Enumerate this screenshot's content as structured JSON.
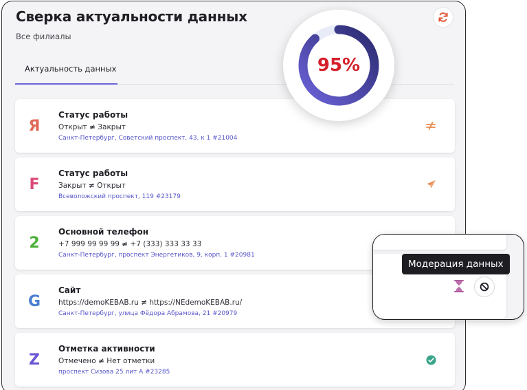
{
  "header": {
    "title": "Сверка актуальности данных",
    "subtitle": "Все филиалы"
  },
  "tabs": [
    {
      "label": "Актуальность данных",
      "active": true
    }
  ],
  "progress": {
    "value": 95,
    "label": "95%",
    "color": "#d4202a",
    "ring_colors": [
      "#6c63d9",
      "#2a2a6e"
    ],
    "track_color": "#e8ecf8"
  },
  "cards": [
    {
      "letter": "Я",
      "letter_color": "#e06a58",
      "title": "Статус работы",
      "compare": {
        "left": "Открыт",
        "sign": "≠",
        "right": "Закрыт"
      },
      "address": "Санкт-Петербург, Советский проспект, 43, к 1 #21004",
      "status_icon": "not-equal-icon",
      "status_color": "#e8894d"
    },
    {
      "letter": "F",
      "letter_color": "#d94a77",
      "title": "Статус работы",
      "compare": {
        "left": "Закрыт",
        "sign": "≠",
        "right": "Открыт"
      },
      "address": "Всеволожский проспект, 119 #23179",
      "status_icon": "send-icon",
      "status_color": "#e8894d"
    },
    {
      "letter": "2",
      "letter_color": "#4caf3a",
      "title": "Основной телефон",
      "compare": {
        "left": "+7 999 99 99 99",
        "sign": "≠",
        "right": "+7 (333) 333 33 33"
      },
      "address": "Санкт-Петербург, проспект Энергетиков, 9, корп. 1 #20981",
      "status_icon": "",
      "status_color": ""
    },
    {
      "letter": "G",
      "letter_color": "#4a7fd1",
      "title": "Сайт",
      "compare": {
        "left": "https://demoKEBAB.ru",
        "sign": "≠",
        "right": "https://NEdemoKEBAB.ru/"
      },
      "address": "Санкт-Петербург, улица Фёдора Абрамова, 21 #20979",
      "status_icon": "",
      "status_color": ""
    },
    {
      "letter": "Z",
      "letter_color": "#6a56d4",
      "title": "Отметка активности",
      "compare": {
        "left": "Отмечено",
        "sign": "≠",
        "right": "Нет отметки"
      },
      "address": "проспект Сизова 25 лит А #23285",
      "status_icon": "check-circle-icon",
      "status_color": "#3aa58a"
    }
  ],
  "zoom": {
    "tooltip": "Модерация данных",
    "hourglass_color": "#b05a9c",
    "block_icon": "block-icon"
  },
  "icons": {
    "refresh": "refresh-icon",
    "refresh_color": "#e15a3c"
  }
}
